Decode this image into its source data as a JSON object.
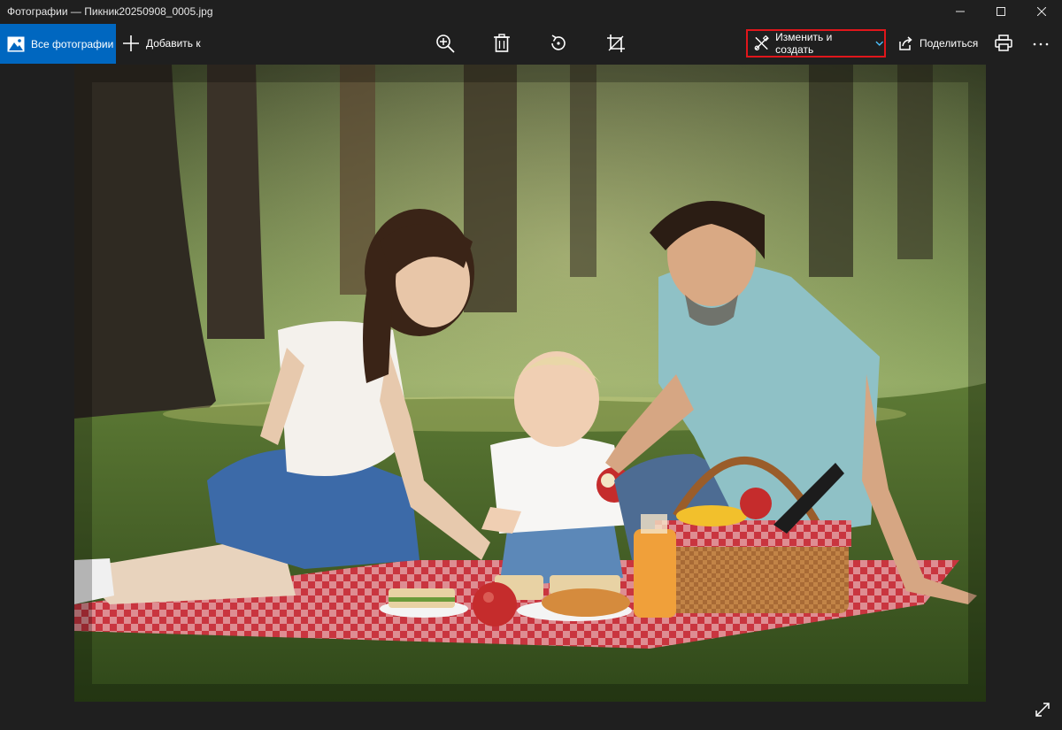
{
  "window": {
    "title": "Фотографии — Пикник20250908_0005.jpg",
    "controls": [
      "minimize-icon",
      "maximize-icon",
      "close-icon"
    ]
  },
  "toolbar": {
    "all_photos_label": "Все фотографии",
    "add_to_label": "Добавить к",
    "tools": [
      "zoom-in-icon",
      "delete-icon",
      "rotate-icon",
      "crop-icon"
    ],
    "edit_create_label": "Изменить и создать",
    "share_label": "Поделиться",
    "print_icon": "print-icon",
    "more_icon": "more-icon",
    "highlight_color": "#e0161b",
    "accent_color": "#0067c0"
  },
  "photo": {
    "subject": "family-picnic-photo"
  },
  "footer": {
    "expand_icon": "fullscreen-icon"
  }
}
